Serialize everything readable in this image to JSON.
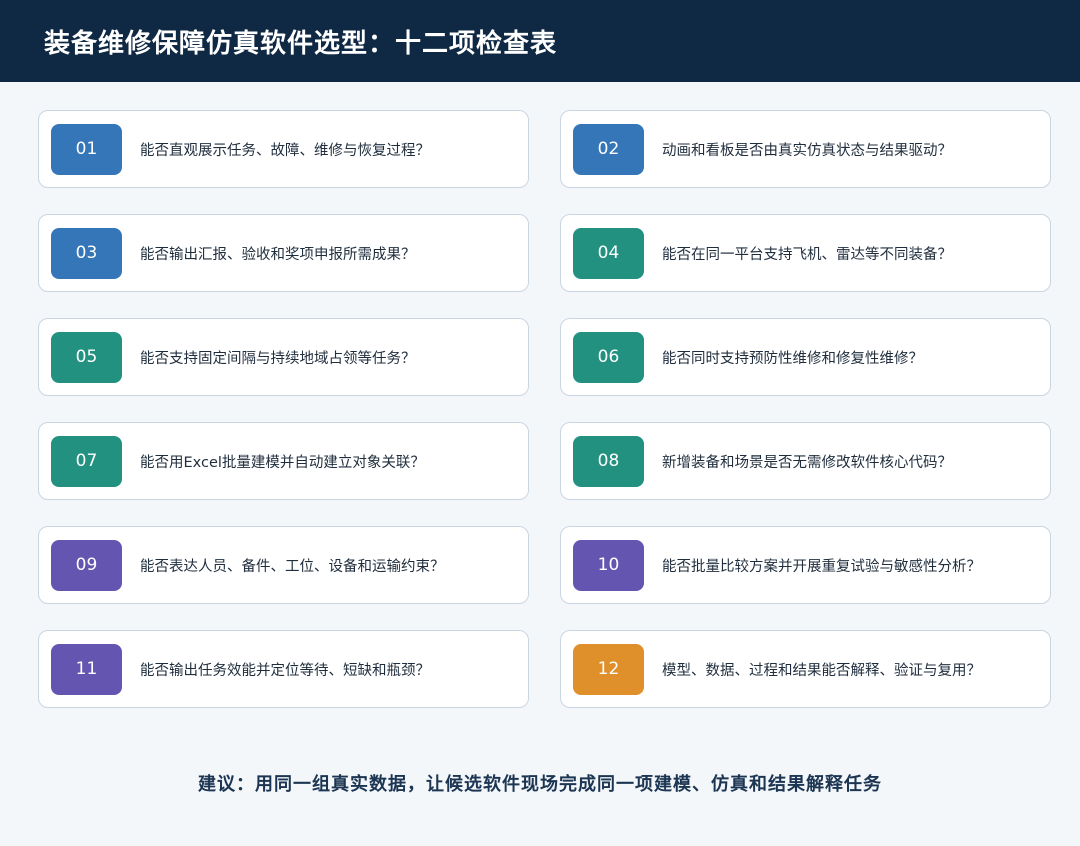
{
  "header": {
    "title": "装备维修保障仿真软件选型：十二项检查表"
  },
  "colors": {
    "blue": "#3576b8",
    "teal": "#23917f",
    "purple": "#6456b0",
    "orange": "#e0902b"
  },
  "items": [
    {
      "num": "01",
      "text": "能否直观展示任务、故障、维修与恢复过程？",
      "color": "#3576b8"
    },
    {
      "num": "02",
      "text": "动画和看板是否由真实仿真状态与结果驱动？",
      "color": "#3576b8"
    },
    {
      "num": "03",
      "text": "能否输出汇报、验收和奖项申报所需成果？",
      "color": "#3576b8"
    },
    {
      "num": "04",
      "text": "能否在同一平台支持飞机、雷达等不同装备？",
      "color": "#23917f"
    },
    {
      "num": "05",
      "text": "能否支持固定间隔与持续地域占领等任务？",
      "color": "#23917f"
    },
    {
      "num": "06",
      "text": "能否同时支持预防性维修和修复性维修？",
      "color": "#23917f"
    },
    {
      "num": "07",
      "text": "能否用Excel批量建模并自动建立对象关联？",
      "color": "#23917f"
    },
    {
      "num": "08",
      "text": "新增装备和场景是否无需修改软件核心代码？",
      "color": "#23917f"
    },
    {
      "num": "09",
      "text": "能否表达人员、备件、工位、设备和运输约束？",
      "color": "#6456b0"
    },
    {
      "num": "10",
      "text": "能否批量比较方案并开展重复试验与敏感性分析？",
      "color": "#6456b0"
    },
    {
      "num": "11",
      "text": "能否输出任务效能并定位等待、短缺和瓶颈？",
      "color": "#6456b0"
    },
    {
      "num": "12",
      "text": "模型、数据、过程和结果能否解释、验证与复用？",
      "color": "#e0902b"
    }
  ],
  "footer": {
    "text": "建议：用同一组真实数据，让候选软件现场完成同一项建模、仿真和结果解释任务"
  }
}
